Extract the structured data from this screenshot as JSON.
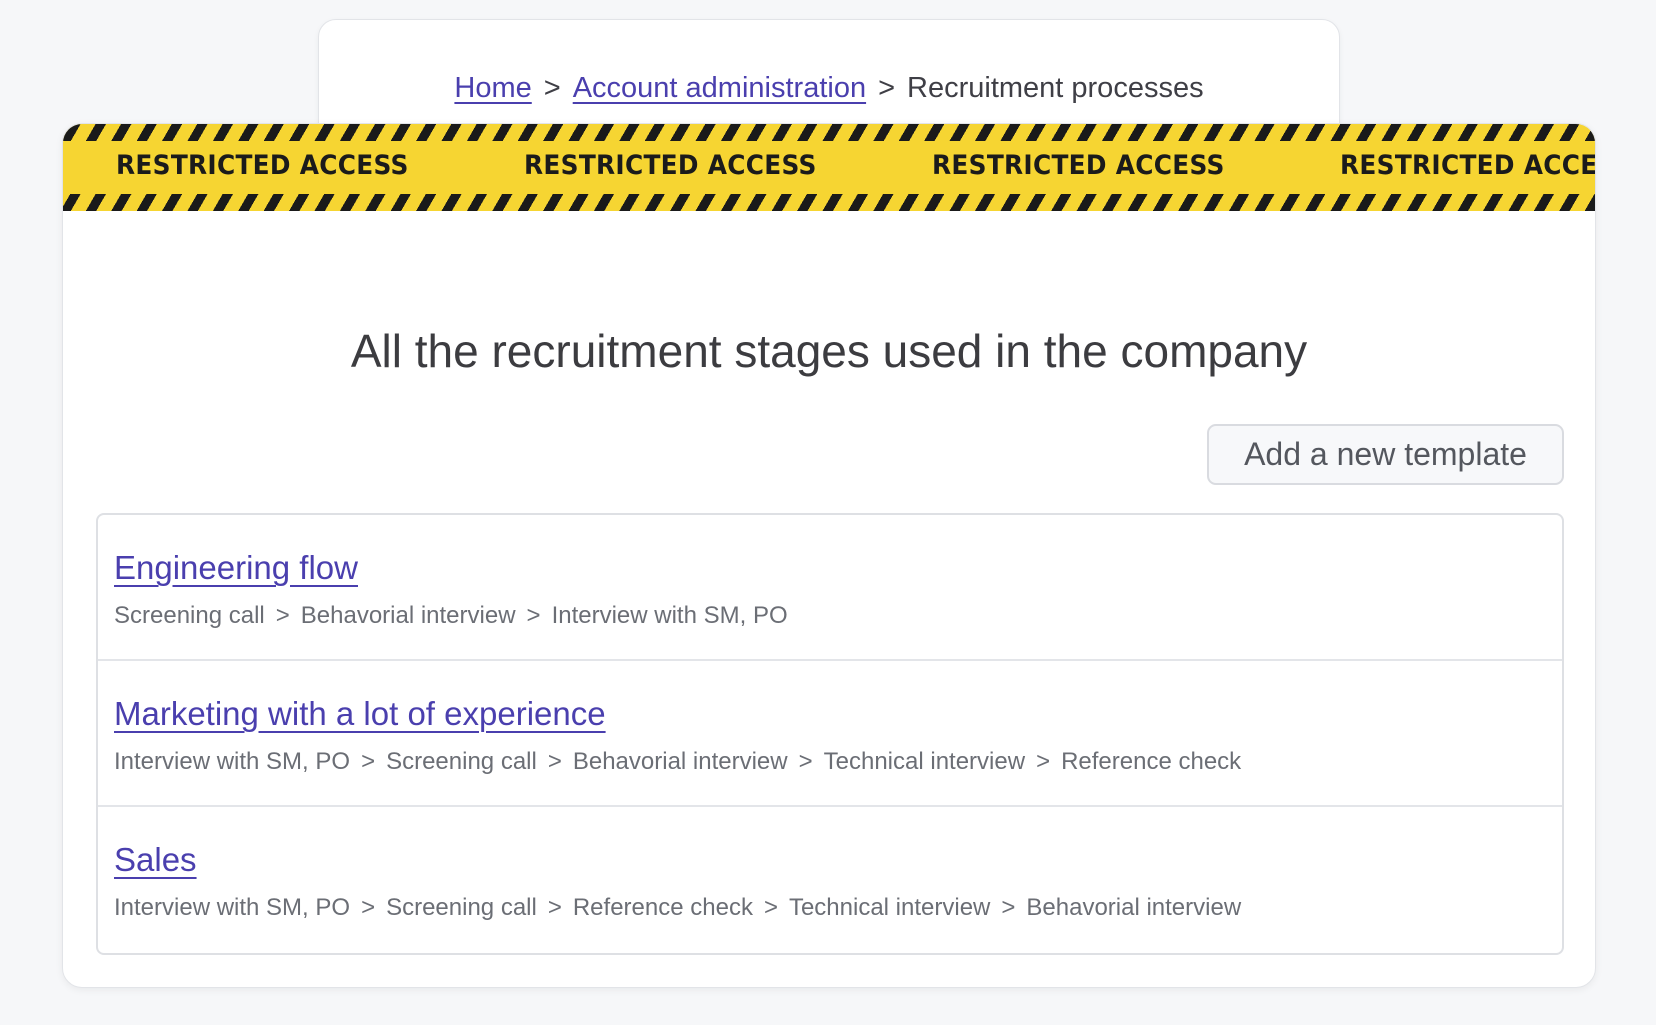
{
  "breadcrumb": {
    "home": "Home",
    "account_admin": "Account administration",
    "current": "Recruitment processes",
    "separator": ">"
  },
  "banner": {
    "text": "RESTRICTED ACCESS",
    "colors": {
      "tape": "#f6d532",
      "stripe": "#1a1a1a"
    }
  },
  "page": {
    "heading": "All the recruitment stages used in the company",
    "add_button": "Add a new template"
  },
  "templates": [
    {
      "name": "Engineering flow",
      "stages": [
        "Screening call",
        "Behavorial interview",
        "Interview with SM, PO"
      ]
    },
    {
      "name": "Marketing with a lot of experience",
      "stages": [
        "Interview with SM, PO",
        "Screening call",
        "Behavorial interview",
        "Technical interview",
        "Reference check"
      ]
    },
    {
      "name": "Sales",
      "stages": [
        "Interview with SM, PO",
        "Screening call",
        "Reference check",
        "Technical interview",
        "Behavorial interview"
      ]
    }
  ],
  "colors": {
    "link": "#4a3fae",
    "muted_text": "#6b6e75",
    "background": "#f6f7f9"
  }
}
